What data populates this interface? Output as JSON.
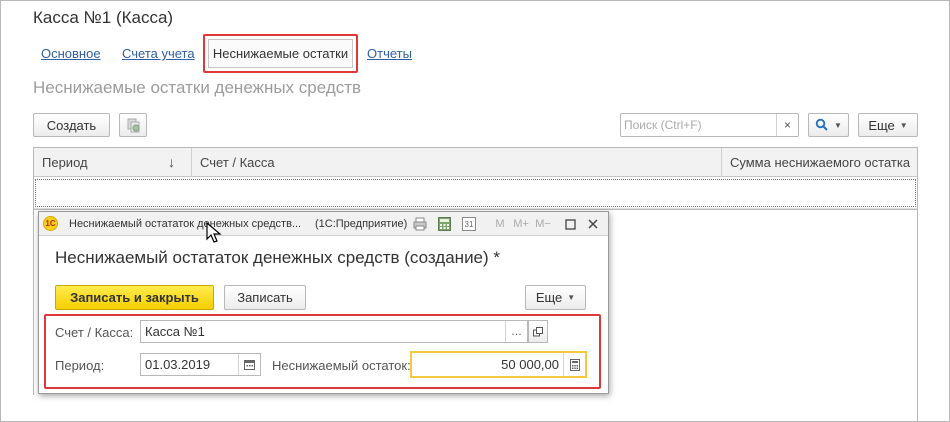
{
  "window": {
    "title": "Касса №1 (Касса)",
    "tabs": [
      {
        "label": "Основное"
      },
      {
        "label": "Счета учета"
      },
      {
        "label": "Неснижаемые остатки"
      },
      {
        "label": "Отчеты"
      }
    ],
    "subtitle": "Неснижаемые остатки денежных средств"
  },
  "toolbar": {
    "create_label": "Создать",
    "search_placeholder": "Поиск (Ctrl+F)",
    "clear_icon": "×",
    "more_label": "Еще"
  },
  "table": {
    "columns": [
      "Период",
      "Счет / Касса",
      "Сумма неснижаемого остатка"
    ],
    "sort_indicator": "↓"
  },
  "dialog": {
    "caption": "Неснижаемый остататок денежных средств...",
    "app_name": "(1С:Предприятие)",
    "logo_text": "1С",
    "title": "Неснижаемый остататок денежных средств (создание) *",
    "save_close_label": "Записать и закрыть",
    "save_label": "Записать",
    "more_label": "Еще",
    "fields": {
      "account_label": "Счет / Касса:",
      "account_value": "Касса №1",
      "period_label": "Период:",
      "period_value": "01.03.2019",
      "balance_label": "Неснижаемый остаток:",
      "balance_value": "50 000,00"
    },
    "toolbar_icons": {
      "m": "M",
      "m_plus": "M+",
      "m_minus": "M−",
      "calendar_day": "31"
    }
  },
  "colors": {
    "accent_red": "#e0383a",
    "primary_yellow": "#f5cf00",
    "link_blue": "#2f5fa5"
  }
}
